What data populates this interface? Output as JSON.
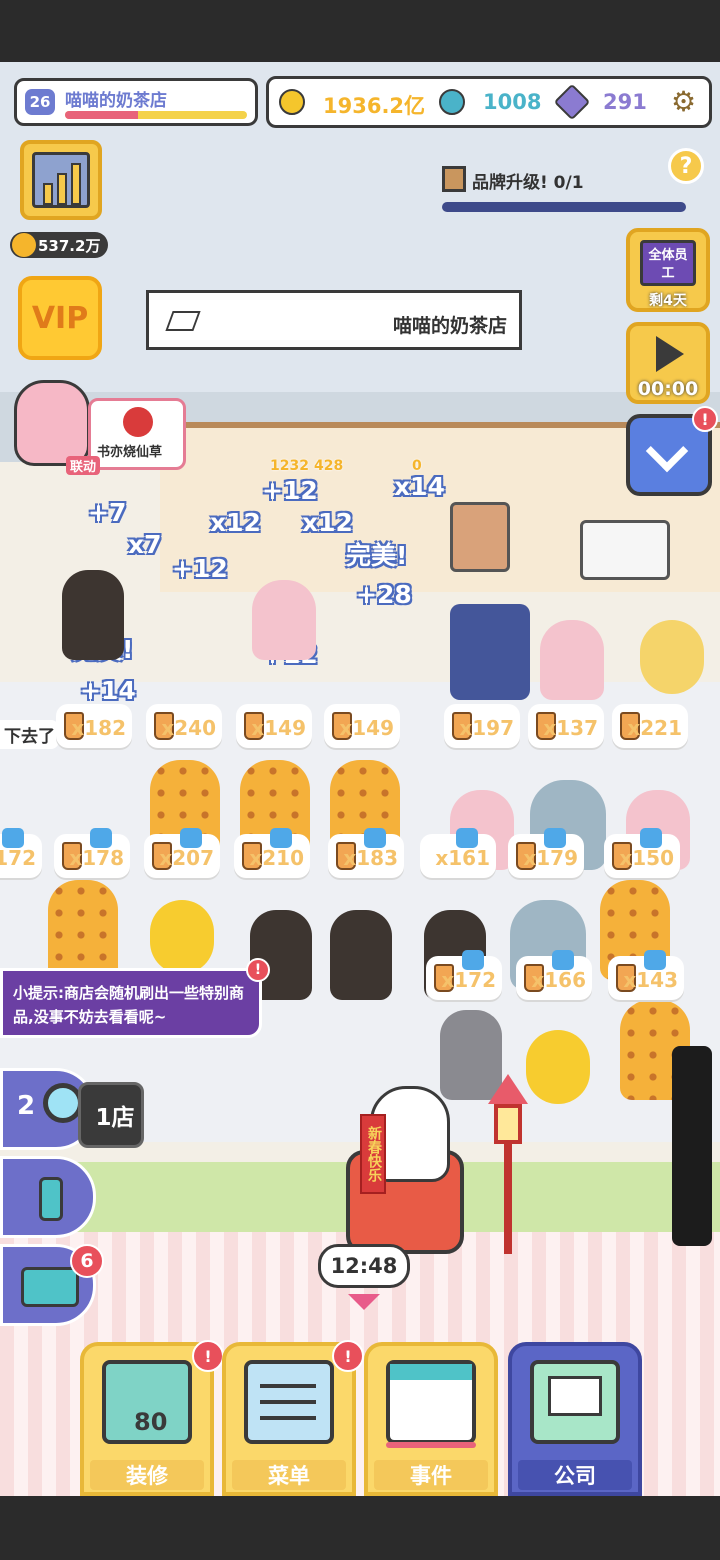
{
  "header": {
    "level": "26",
    "shop_name": "喵喵的奶茶店",
    "shop_progress": 0.4,
    "coins": "1936.2亿",
    "gems_teal": "1008",
    "diamonds": "291",
    "settings_icon": "gear-icon",
    "coin_color": "#f5b52c",
    "teal_color": "#4ab3c9",
    "diamond_color": "#8b7bd1"
  },
  "brand": {
    "label": "品牌升级!  0/1",
    "help": "?"
  },
  "left_buttons": {
    "stats_icon": "bar-chart-icon",
    "income": "537.2万",
    "vip_label": "VIP"
  },
  "right_buttons": {
    "staff_label": "全体员工",
    "staff_days": "剩4天",
    "play_time": "00:00",
    "alert": "!"
  },
  "sign": {
    "text": "喵喵的奶茶店"
  },
  "collab": {
    "brand": "书亦烧仙草",
    "tag": "联动"
  },
  "floats": {
    "f1": "+7",
    "f2": "x7",
    "f3": "x12",
    "f4": "+12",
    "f5": "x12",
    "f6": "+12",
    "f7": "x14",
    "f8": "完美!",
    "f9": "+28",
    "f10": "+12",
    "f11": "完美!",
    "f12": "+14",
    "f13": "+12",
    "y1": "1232",
    "y2": "428",
    "y3": "0",
    "left_edge": "下去了"
  },
  "orders_row1": [
    "x182",
    "x240",
    "x149",
    "x149",
    "x197",
    "x137",
    "x221"
  ],
  "orders_row2": [
    "x172",
    "x178",
    "x207",
    "x210",
    "x183",
    "x161",
    "x179",
    "x150"
  ],
  "orders_row3": [
    "x172",
    "x166",
    "x143"
  ],
  "tip": {
    "text": "小提示:商店会随机刷出一些特别商品,没事不妨去看看呢~"
  },
  "side_tools": {
    "search_count": "2",
    "store_label": "1店",
    "inbox_badge": "6"
  },
  "lucky_cat": {
    "banner": "新春快乐"
  },
  "timer": "12:48",
  "nav": {
    "decorate": "装修",
    "decorate_level": "80",
    "menu": "菜单",
    "events": "事件",
    "company": "公司",
    "active": "公司"
  }
}
